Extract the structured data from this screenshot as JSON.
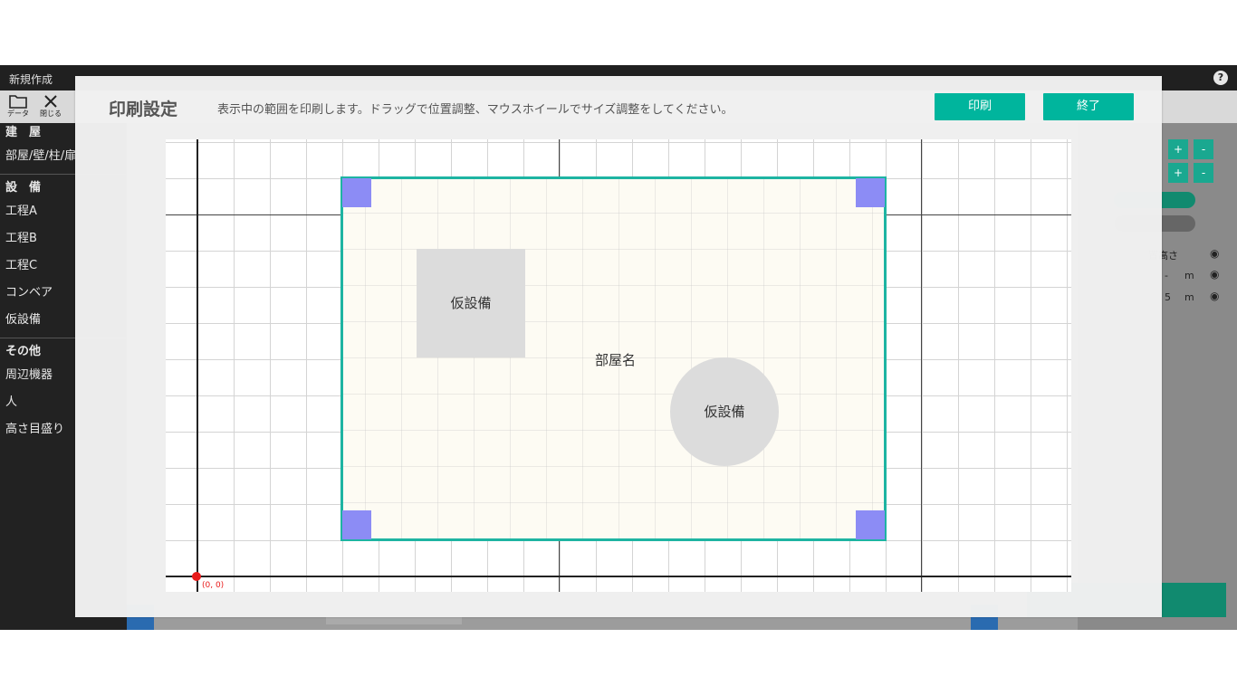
{
  "app": {
    "title": "新規作成",
    "help_glyph": "?"
  },
  "toolbar": {
    "data_label": "データ",
    "close_label": "閉じる"
  },
  "sidebar": {
    "sections": [
      {
        "heading": "建　屋",
        "items": [
          "部屋/壁/柱/扉"
        ]
      },
      {
        "heading": "設　備",
        "items": [
          "工程A",
          "工程B",
          "工程C",
          "コンベア",
          "仮設備"
        ]
      },
      {
        "heading": "その他",
        "items": [
          "周辺機器",
          "人",
          "高さ目盛り"
        ]
      }
    ]
  },
  "right_panel": {
    "height_label": "置高さ",
    "row1_value": "-",
    "row2_value": "5",
    "unit": "m",
    "plus_glyph": "+",
    "minus_glyph": "-"
  },
  "modal": {
    "title": "印刷設定",
    "description": "表示中の範囲を印刷します。ドラッグで位置調整、マウスホイールでサイズ調整をしてください。",
    "print_button": "印刷",
    "end_button": "終了"
  },
  "canvas": {
    "origin_label": "(0, 0)",
    "room_name": "部屋名",
    "equipment_rect_label": "仮設備",
    "equipment_circle_label": "仮設備"
  },
  "colors": {
    "accent": "#00b59d",
    "selection_border": "#1eb4a2",
    "handle": "#8c8cf5",
    "origin": "#e81b1b",
    "sidebar_bg": "#222222"
  }
}
